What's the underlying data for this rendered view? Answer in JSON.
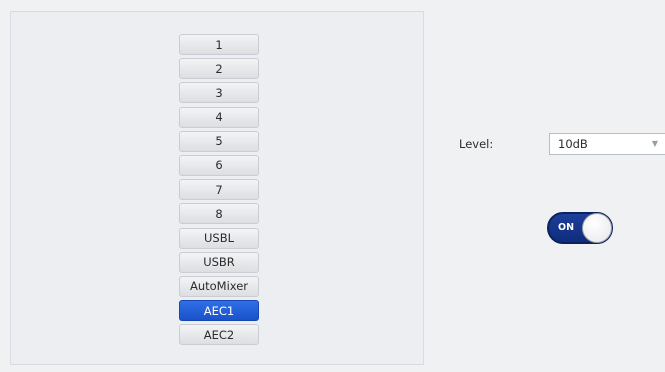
{
  "channels": {
    "items": [
      "1",
      "2",
      "3",
      "4",
      "5",
      "6",
      "7",
      "8",
      "USBL",
      "USBR",
      "AutoMixer",
      "AEC1",
      "AEC2"
    ],
    "selected": "AEC1"
  },
  "level": {
    "label": "Level:",
    "value": "10dB"
  },
  "toggle": {
    "label": "ON",
    "state": "on"
  },
  "colors": {
    "selected_accent": "#2f6fe8",
    "toggle_bg": "#1d3f9a"
  }
}
